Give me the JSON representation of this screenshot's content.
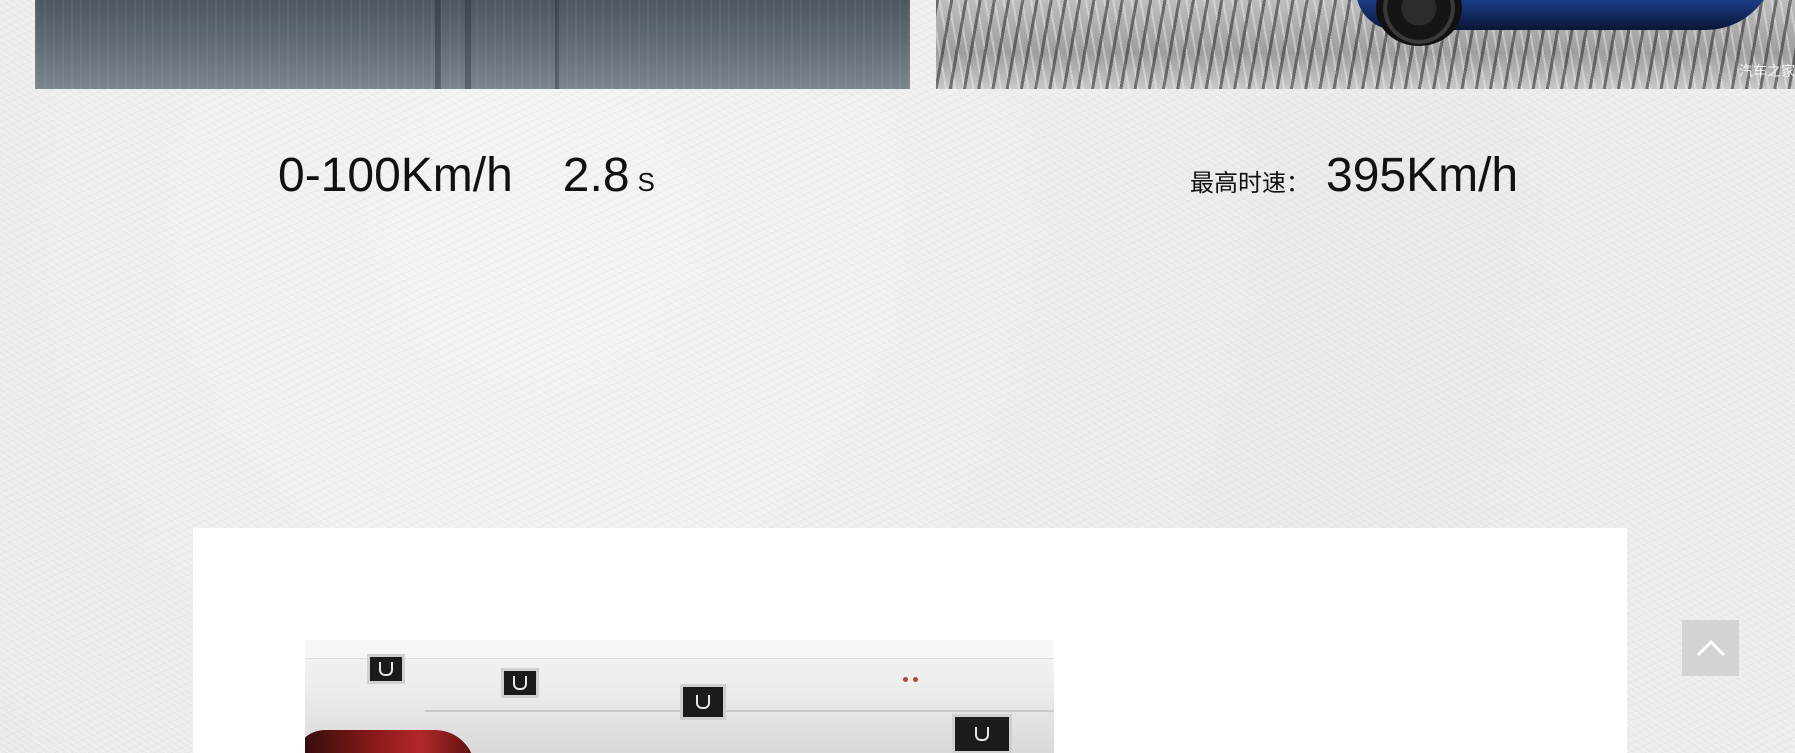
{
  "top_photos": {
    "right_watermark": "汽车之家"
  },
  "specs": {
    "acceleration": {
      "label": "0-100Km/h",
      "value": "2.8",
      "unit": "S"
    },
    "top_speed": {
      "label": "最高时速：",
      "value": "395Km/h"
    }
  },
  "back_to_top": {
    "icon": "chevron-up-icon"
  },
  "colors": {
    "page_background": "#ececec",
    "card_background": "#ffffff",
    "back_to_top_background": "#d3d3d3"
  }
}
